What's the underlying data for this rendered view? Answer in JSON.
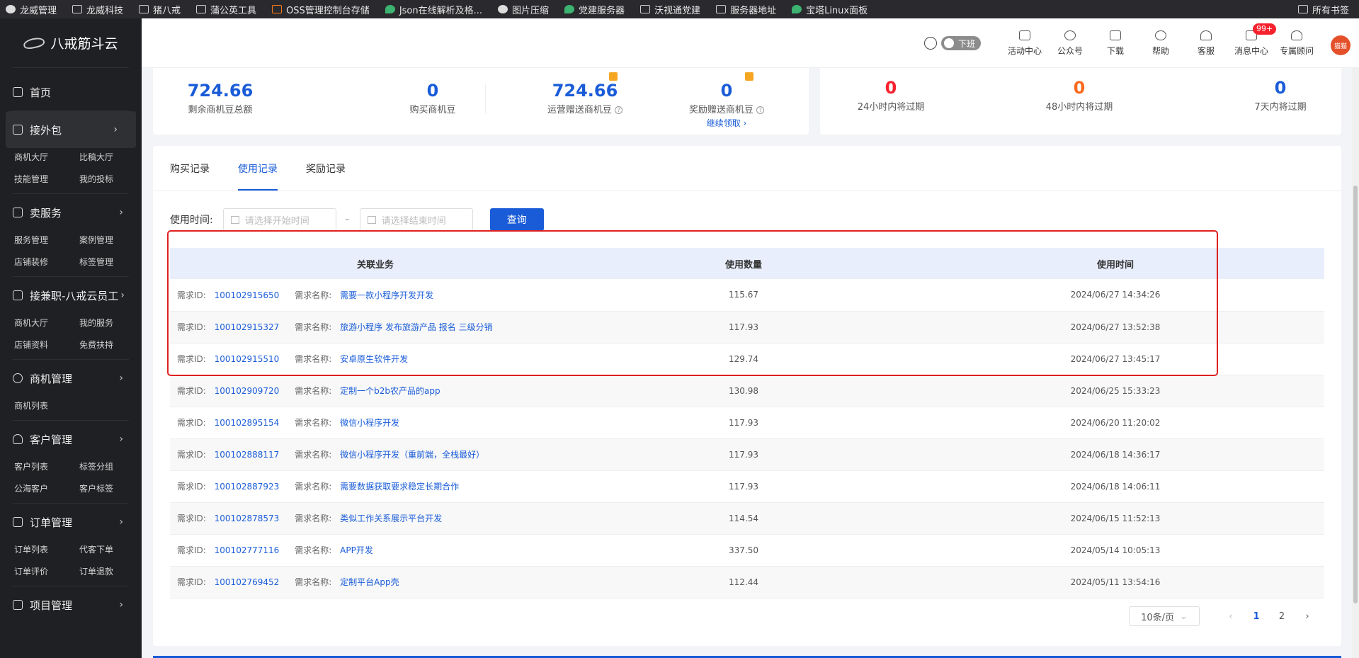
{
  "bookmarks": {
    "items": [
      "龙威管理",
      "龙威科技",
      "猪八戒",
      "蒲公英工具",
      "OSS管理控制台存储",
      "Json在线解析及格...",
      "图片压缩",
      "党建服务器",
      "沃视通党建",
      "服务器地址",
      "宝塔Linux面板"
    ],
    "right": "所有书签"
  },
  "sidebar": {
    "brand": "八戒筋斗云",
    "home": "首页",
    "sec1": {
      "title": "接外包",
      "links": [
        "商机大厅",
        "比稿大厅",
        "技能管理",
        "我的投标"
      ]
    },
    "sec2": {
      "title": "卖服务",
      "links": [
        "服务管理",
        "案例管理",
        "店铺装修",
        "标签管理"
      ]
    },
    "sec3": {
      "title": "接兼职-八戒云员工",
      "links": [
        "商机大厅",
        "我的服务",
        "店铺资料",
        "免费扶持"
      ]
    },
    "sec4": {
      "title": "商机管理",
      "links": [
        "商机列表"
      ]
    },
    "sec5": {
      "title": "客户管理",
      "links": [
        "客户列表",
        "标签分组",
        "公海客户",
        "客户标签"
      ]
    },
    "sec6": {
      "title": "订单管理",
      "links": [
        "订单列表",
        "代客下单",
        "订单评价",
        "订单退款"
      ]
    },
    "sec7": {
      "title": "项目管理"
    }
  },
  "topbar": {
    "toggle": "下班",
    "items": [
      "活动中心",
      "公众号",
      "下载",
      "帮助",
      "客服",
      "消息中心",
      "专属顾问"
    ],
    "badge": "99+",
    "avatar": "猫猫"
  },
  "stats": {
    "total": {
      "value": "724.66",
      "label": "剩余商机豆总额"
    },
    "bought": {
      "value": "0",
      "label": "购买商机豆"
    },
    "ops": {
      "value": "724.66",
      "label": "运营赠送商机豆"
    },
    "reward": {
      "value": "0",
      "label": "奖励赠送商机豆",
      "link": "继续领取 ›"
    },
    "exp24": {
      "value": "0",
      "label": "24小时内将过期"
    },
    "exp48": {
      "value": "0",
      "label": "48小时内将过期"
    },
    "exp7d": {
      "value": "0",
      "label": "7天内将过期"
    }
  },
  "tabs": [
    "购买记录",
    "使用记录",
    "奖励记录"
  ],
  "filter": {
    "label": "使用时间:",
    "start": "请选择开始时间",
    "end": "请选择结束时间",
    "sep": "–",
    "button": "查询"
  },
  "table": {
    "headers": [
      "关联业务",
      "使用数量",
      "使用时间"
    ],
    "id_key": "需求ID:",
    "name_key": "需求名称:",
    "rows": [
      {
        "id": "100102915650",
        "name": "需要一款小程序开发开发",
        "qty": "115.67",
        "time": "2024/06/27 14:34:26"
      },
      {
        "id": "100102915327",
        "name": "旅游小程序 发布旅游产品 报名 三级分销",
        "qty": "117.93",
        "time": "2024/06/27 13:52:38"
      },
      {
        "id": "100102915510",
        "name": "安卓原生软件开发",
        "qty": "129.74",
        "time": "2024/06/27 13:45:17"
      },
      {
        "id": "100102909720",
        "name": "定制一个b2b农产品的app",
        "qty": "130.98",
        "time": "2024/06/25 15:33:23"
      },
      {
        "id": "100102895154",
        "name": "微信小程序开发",
        "qty": "117.93",
        "time": "2024/06/20 11:20:02"
      },
      {
        "id": "100102888117",
        "name": "微信小程序开发（重前端，全栈最好）",
        "qty": "117.93",
        "time": "2024/06/18 14:36:17"
      },
      {
        "id": "100102887923",
        "name": "需要数据获取要求稳定长期合作",
        "qty": "117.93",
        "time": "2024/06/18 14:06:11"
      },
      {
        "id": "100102878573",
        "name": "类似工作关系展示平台开发",
        "qty": "114.54",
        "time": "2024/06/15 11:52:13"
      },
      {
        "id": "100102777116",
        "name": "APP开发",
        "qty": "337.50",
        "time": "2024/05/14 10:05:13"
      },
      {
        "id": "100102769452",
        "name": "定制平台App壳",
        "qty": "112.44",
        "time": "2024/05/11 13:54:16"
      }
    ]
  },
  "pager": {
    "size": "10条/页",
    "pages": [
      "1",
      "2"
    ],
    "prev": "‹",
    "next": "›"
  },
  "colors": {
    "accent": "#1a5cd8",
    "highlight_box": "#e02020"
  }
}
